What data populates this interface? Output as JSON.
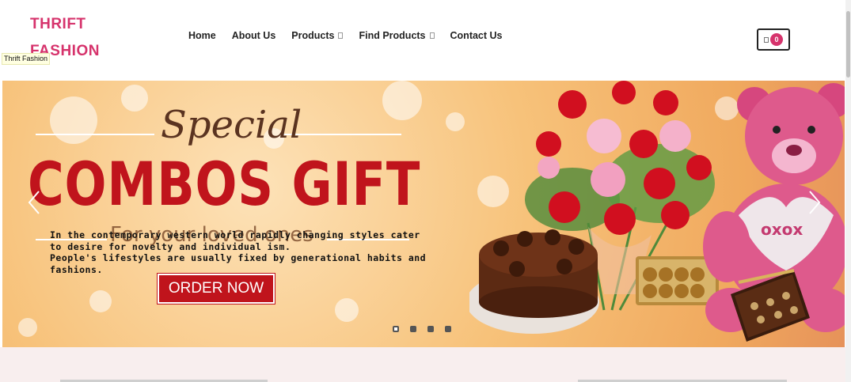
{
  "header": {
    "logo_line1": "THRIFT",
    "logo_line2": "FASHION",
    "logo_tooltip": "Thrift Fashion",
    "brand_color": "#d6336c"
  },
  "nav": {
    "items": [
      {
        "label": "Home",
        "has_dropdown": false
      },
      {
        "label": "About Us",
        "has_dropdown": false
      },
      {
        "label": "Products",
        "has_dropdown": true
      },
      {
        "label": "Find Products",
        "has_dropdown": true
      },
      {
        "label": "Contact Us",
        "has_dropdown": false
      }
    ]
  },
  "cart": {
    "icon": "shopping-bag-icon",
    "count": "0"
  },
  "banner": {
    "heading_script": "Special",
    "heading_main": "COMBOS GIFT",
    "subheading": "For your loved ones",
    "cta_label": "ORDER NOW",
    "description": [
      "In the contemporary western world rapidly changing styles cater to desire for novelty and individual ism.",
      "People's lifestyles are usually fixed by generational habits and fashions."
    ],
    "accent_color": "#c0141c",
    "slide_count": 4,
    "active_slide": 1
  }
}
